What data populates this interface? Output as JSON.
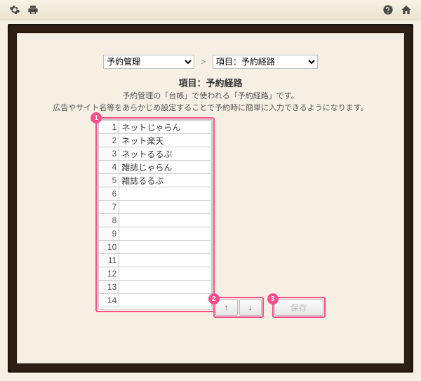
{
  "toolbar": {
    "settings_icon": "gear-icon",
    "print_icon": "printer-icon",
    "help_icon": "help-icon",
    "home_icon": "home-icon"
  },
  "selects": {
    "category": {
      "selected": "予約管理"
    },
    "item": {
      "selected": "項目：予約経路"
    },
    "separator": ">"
  },
  "heading": "項目：予約経路",
  "description_line1": "予約管理の「台帳」で使われる「予約経路」です。",
  "description_line2": "広告やサイト名等をあらかじめ設定することで予約時に簡単に入力できるようになります。",
  "annotations": {
    "list": "1",
    "arrows": "2",
    "save": "3"
  },
  "list": {
    "rows": [
      {
        "n": "1",
        "v": "ネットじゃらん"
      },
      {
        "n": "2",
        "v": "ネット楽天"
      },
      {
        "n": "3",
        "v": "ネットるるぶ"
      },
      {
        "n": "4",
        "v": "雑誌じゃらん"
      },
      {
        "n": "5",
        "v": "雑誌るるぶ"
      },
      {
        "n": "6",
        "v": ""
      },
      {
        "n": "7",
        "v": ""
      },
      {
        "n": "8",
        "v": ""
      },
      {
        "n": "9",
        "v": ""
      },
      {
        "n": "10",
        "v": ""
      },
      {
        "n": "11",
        "v": ""
      },
      {
        "n": "12",
        "v": ""
      },
      {
        "n": "13",
        "v": ""
      },
      {
        "n": "14",
        "v": ""
      }
    ]
  },
  "buttons": {
    "up": "↑",
    "down": "↓",
    "save": "保存"
  }
}
